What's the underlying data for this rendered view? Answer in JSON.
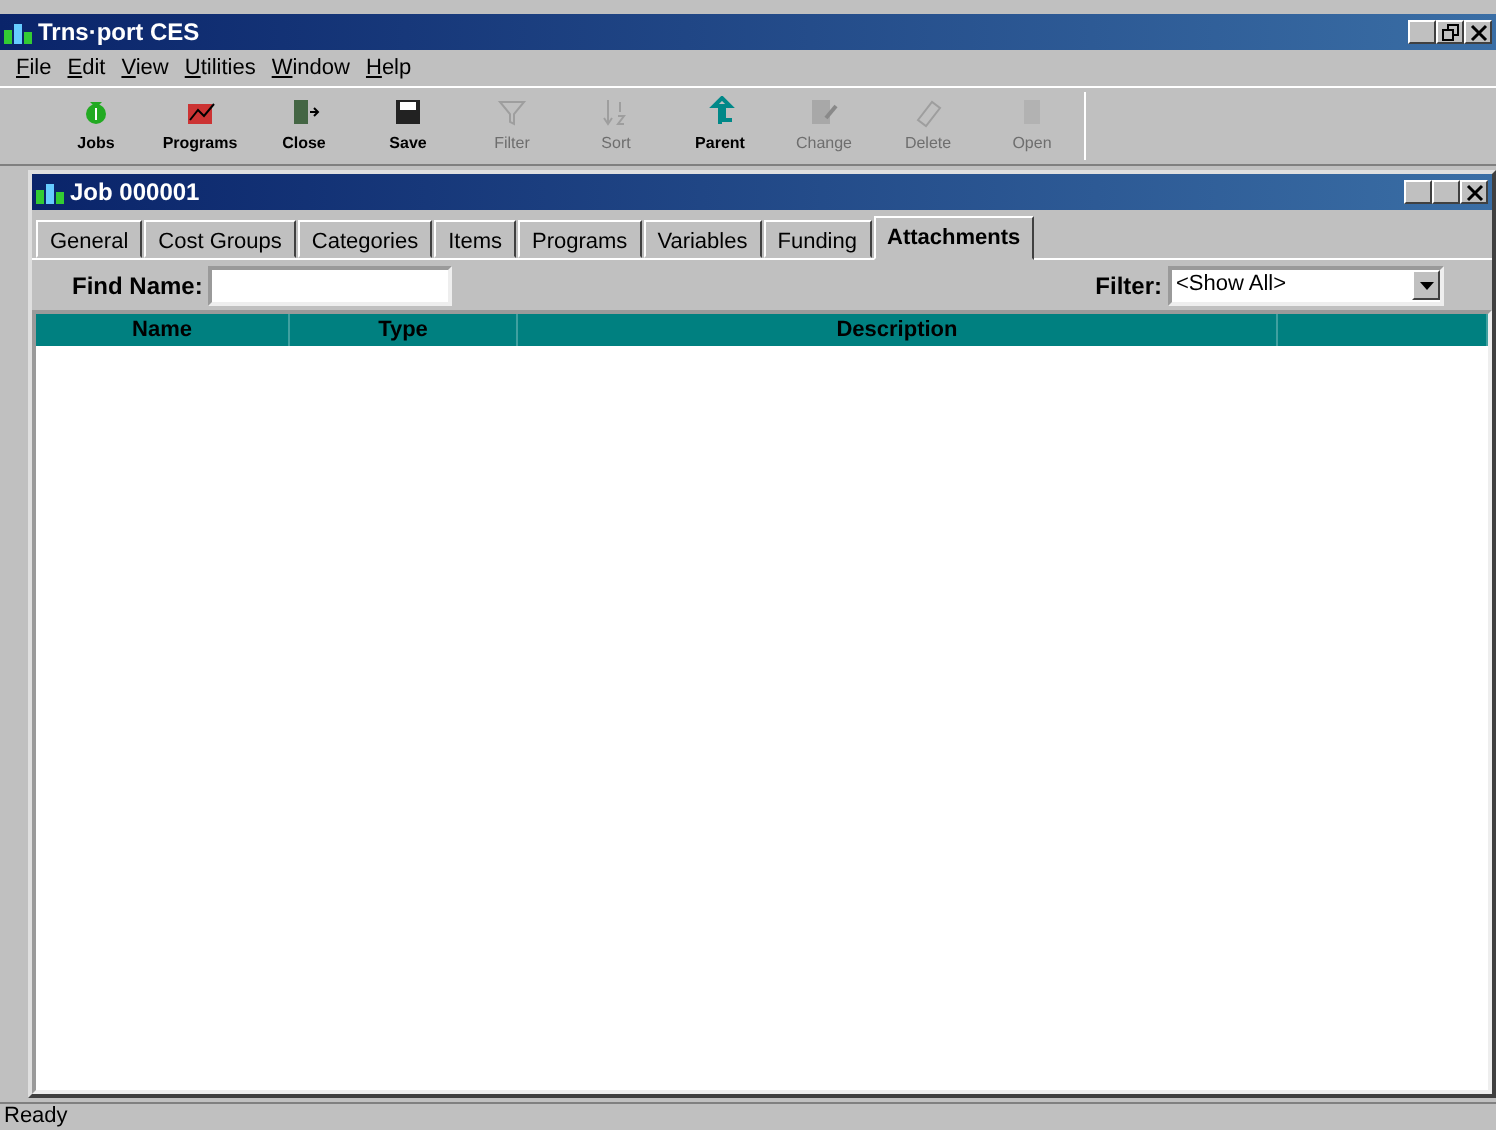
{
  "window": {
    "title": "Trns·port CES"
  },
  "menu": [
    {
      "label": "File"
    },
    {
      "label": "Edit"
    },
    {
      "label": "View"
    },
    {
      "label": "Utilities"
    },
    {
      "label": "Window"
    },
    {
      "label": "Help"
    }
  ],
  "toolbar": [
    {
      "kind": "jobs",
      "label": "Jobs",
      "disabled": false
    },
    {
      "kind": "programs",
      "label": "Programs",
      "disabled": false
    },
    {
      "kind": "close",
      "label": "Close",
      "disabled": false
    },
    {
      "kind": "save",
      "label": "Save",
      "disabled": false
    },
    {
      "kind": "filter",
      "label": "Filter",
      "disabled": true
    },
    {
      "kind": "sort",
      "label": "Sort",
      "disabled": true
    },
    {
      "kind": "parent",
      "label": "Parent",
      "disabled": false
    },
    {
      "kind": "change",
      "label": "Change",
      "disabled": true
    },
    {
      "kind": "delete",
      "label": "Delete",
      "disabled": true
    },
    {
      "kind": "open",
      "label": "Open",
      "disabled": true
    }
  ],
  "child_window": {
    "title": "Job 000001",
    "tabs": [
      {
        "label": "General",
        "selected": false
      },
      {
        "label": "Cost Groups",
        "selected": false
      },
      {
        "label": "Categories",
        "selected": false
      },
      {
        "label": "Items",
        "selected": false
      },
      {
        "label": "Programs",
        "selected": false
      },
      {
        "label": "Variables",
        "selected": false
      },
      {
        "label": "Funding",
        "selected": false
      },
      {
        "label": "Attachments",
        "selected": true
      }
    ],
    "find_name": {
      "label": "Find Name:"
    },
    "filter": {
      "label": "Filter:",
      "value": "<Show All>"
    },
    "table": {
      "columns": [
        {
          "label": "Name"
        },
        {
          "label": "Type"
        },
        {
          "label": "Description"
        },
        {}
      ]
    }
  },
  "status_bar": "Ready"
}
